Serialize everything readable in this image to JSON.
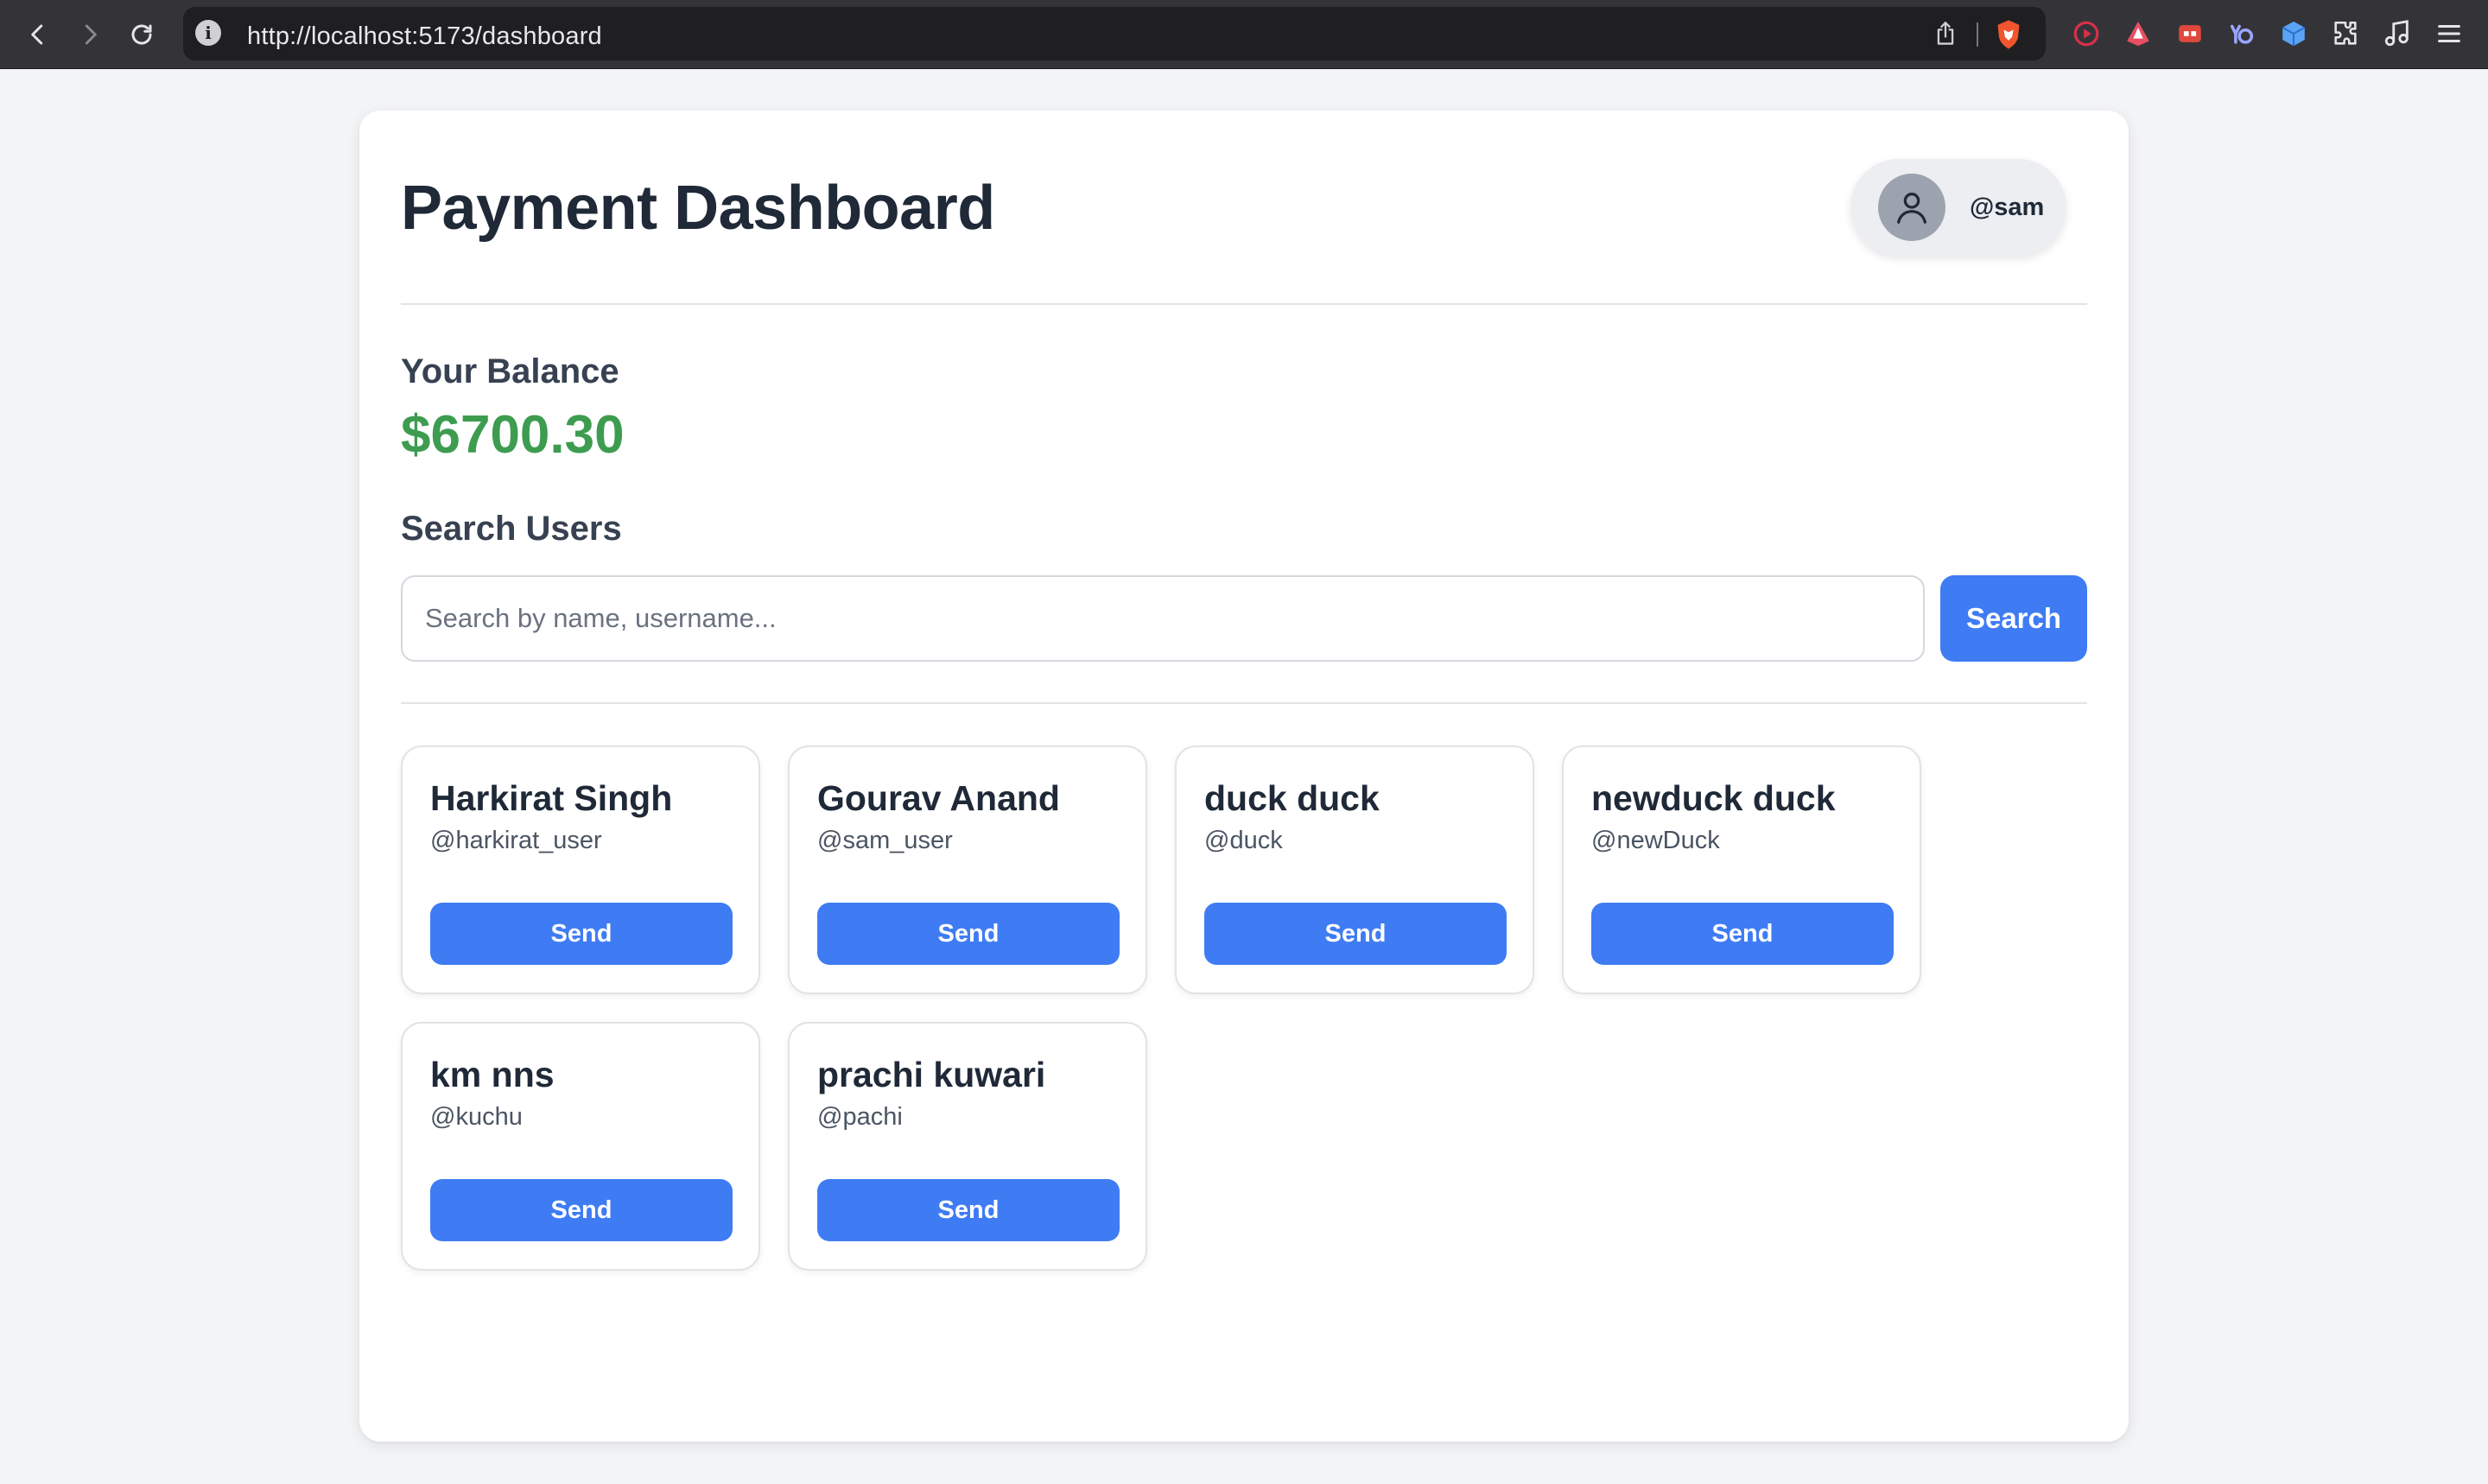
{
  "browser": {
    "url": "http://localhost:5173/dashboard"
  },
  "extensions": [
    {
      "name": "youtube-extension-icon",
      "color": "#d9304a"
    },
    {
      "name": "vpn-extension-icon",
      "color": "#e84f62"
    },
    {
      "name": "screen-extension-icon",
      "color": "#e0483d"
    },
    {
      "name": "yo-extension-icon",
      "color": "#9aa6ff"
    },
    {
      "name": "cube-extension-icon",
      "color": "#5aa3f5"
    },
    {
      "name": "puzzle-extensions-icon",
      "color": "#e6e6e6"
    },
    {
      "name": "music-icon",
      "color": "#e6e6e6"
    },
    {
      "name": "menu-icon",
      "color": "#e6e6e6"
    }
  ],
  "header": {
    "title": "Payment Dashboard",
    "user_handle": "@sam"
  },
  "balance": {
    "label": "Your Balance",
    "amount": "$6700.30",
    "color": "#3d9c4f"
  },
  "search": {
    "label": "Search Users",
    "placeholder": "Search by name, username...",
    "value": "",
    "button_label": "Search"
  },
  "users": [
    {
      "name": "Harkirat Singh",
      "username": "@harkirat_user",
      "send_label": "Send"
    },
    {
      "name": "Gourav Anand",
      "username": "@sam_user",
      "send_label": "Send"
    },
    {
      "name": "duck duck",
      "username": "@duck",
      "send_label": "Send"
    },
    {
      "name": "newduck duck",
      "username": "@newDuck",
      "send_label": "Send"
    },
    {
      "name": "km nns",
      "username": "@kuchu",
      "send_label": "Send"
    },
    {
      "name": "prachi kuwari",
      "username": "@pachi",
      "send_label": "Send"
    }
  ],
  "colors": {
    "accent": "#3f7cf4",
    "text": "#1f2937"
  }
}
